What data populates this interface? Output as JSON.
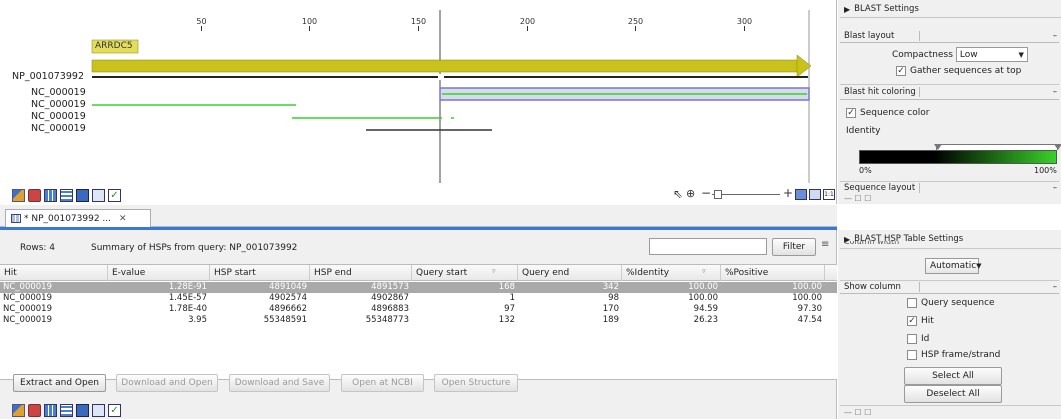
{
  "viewer": {
    "ruler_ticks": [
      {
        "label": "50",
        "pos": 50
      },
      {
        "label": "100",
        "pos": 100
      },
      {
        "label": "150",
        "pos": 150
      },
      {
        "label": "200",
        "pos": 200
      },
      {
        "label": "250",
        "pos": 250
      },
      {
        "label": "300",
        "pos": 300
      }
    ],
    "gene_label": "ARRDC5",
    "query_label": "NP_001073992",
    "hit_labels": [
      "NC_000019",
      "NC_000019",
      "NC_000019",
      "NC_000019"
    ],
    "colors": {
      "gene": "#c9c21a",
      "hit_green": "#39d12a",
      "hit_dark": "#333333",
      "selection": "#7777d0"
    }
  },
  "editor_tab": {
    "label": "* NP_001073992 ..."
  },
  "summary": {
    "rows_label": "Rows: 4",
    "description": "Summary of HSPs from query: NP_001073992",
    "filter_placeholder": "",
    "filter_label": "Filter"
  },
  "table": {
    "columns": [
      "Hit",
      "E-value",
      "HSP start",
      "HSP end",
      "Query start",
      "Query end",
      "%Identity",
      "%Positive"
    ],
    "rows": [
      [
        "NC_000019",
        "1.28E-91",
        "4891049",
        "4891573",
        "168",
        "342",
        "100.00",
        "100.00"
      ],
      [
        "NC_000019",
        "1.45E-57",
        "4902574",
        "4902867",
        "1",
        "98",
        "100.00",
        "100.00"
      ],
      [
        "NC_000019",
        "1.78E-40",
        "4896662",
        "4896883",
        "97",
        "170",
        "94.59",
        "97.30"
      ],
      [
        "NC_000019",
        "3.95",
        "55348591",
        "55348773",
        "132",
        "189",
        "26.23",
        "47.54"
      ]
    ]
  },
  "actions": {
    "extract": "Extract and Open",
    "download_open": "Download and Open",
    "download_save": "Download and Save",
    "open_ncbi": "Open at NCBI",
    "open_structure": "Open Structure"
  },
  "blast_settings": {
    "title": "BLAST Settings",
    "layout_header": "Blast layout",
    "compactness_label": "Compactness",
    "compactness_value": "Low",
    "gather_label": "Gather sequences at top",
    "coloring_header": "Blast hit coloring",
    "sequence_color_label": "Sequence color",
    "identity_label": "Identity",
    "gradient_min": "0%",
    "gradient_max": "100%",
    "sequence_layout_header": "Sequence layout"
  },
  "table_settings": {
    "title": "BLAST HSP Table Settings",
    "cut_label": "Column width",
    "width_value": "Automatic",
    "show_column_header": "Show column",
    "columns": [
      {
        "label": "Query sequence",
        "checked": false
      },
      {
        "label": "Hit",
        "checked": true
      },
      {
        "label": "Id",
        "checked": false
      },
      {
        "label": "HSP frame/strand",
        "checked": false
      }
    ],
    "select_all": "Select All",
    "deselect_all": "Deselect All"
  }
}
